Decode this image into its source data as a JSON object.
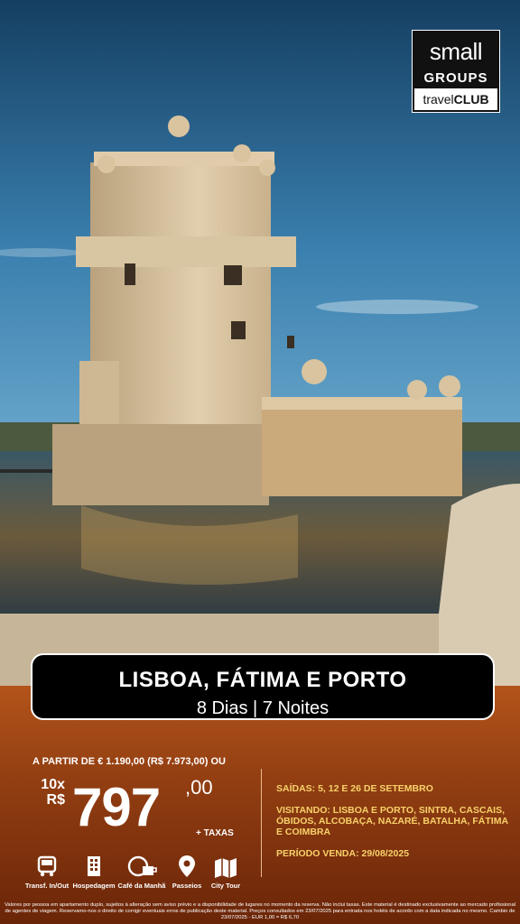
{
  "brand": {
    "line1": "small",
    "line2": "GROUPS",
    "band_light": "travel",
    "band_bold": "CLUB"
  },
  "photo": {
    "subject": "tower-by-river-photo",
    "colors": {
      "sky_top": "#1b4f78",
      "sky_bottom": "#4a8fb8",
      "stone": "#d7c3a1",
      "water": "#2e4a58"
    }
  },
  "title_card": {
    "title": "LISBOA, FÁTIMA E PORTO",
    "subtitle": "8 Dias | 7 Noites"
  },
  "price": {
    "from_text": "A PARTIR DE € 1.190,00 (R$ 7.973,00) OU",
    "installments": "10x",
    "currency": "R$",
    "amount": "797",
    "cents": ",00",
    "taxes": "+ TAXAS"
  },
  "info": {
    "departures": "SAÍDAS: 5, 12 E 26 DE SETEMBRO",
    "visiting": "VISITANDO: LISBOA E PORTO, SINTRA, CASCAIS, ÓBIDOS, ALCOBAÇA, NAZARÉ, BATALHA, FÁTIMA E COIMBRA",
    "sale_period": "PERÍODO VENDA: 29/08/2025"
  },
  "includes": [
    {
      "label": "Transf. In/Out",
      "icon": "bus-icon"
    },
    {
      "label": "Hospedagem",
      "icon": "hotel-icon"
    },
    {
      "label": "Café da Manhã",
      "icon": "breakfast-icon"
    },
    {
      "label": "Passeios",
      "icon": "location-pin-icon"
    },
    {
      "label": "City Tour",
      "icon": "map-icon"
    }
  ],
  "disclaimer": "Valores por pessoa em apartamento duplo, sujeitos à alteração sem aviso prévio e a disponibilidade de lugares no momento da reserva. Não inclui taxas. Este material é destinado exclusivamente ao mercado profissional de agentes de viagem. Reservamo-nos o direito de corrigir eventuais erros de publicação deste material. Preços consultados em 23/07/2025 para entrada nos hotéis de acordo com a data indicada no mesmo. Cambio de 23/07/2025 - EUR 1,00 = R$ 6,70",
  "accent_colors": {
    "orange_panel": "#a84a16",
    "yellow_text": "#f8d26a"
  }
}
